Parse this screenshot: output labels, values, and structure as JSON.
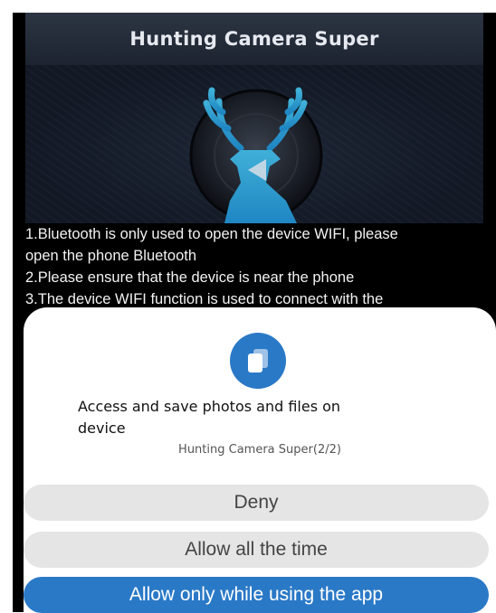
{
  "app": {
    "title": "Hunting Camera Super",
    "instructions": [
      "1.Bluetooth is only used to open the device WIFI, please",
      "open the phone Bluetooth",
      "2.Please ensure that the device is near the phone",
      "3.The device WIFI function is used to connect with the"
    ]
  },
  "dialog": {
    "icon": "files-icon",
    "title_line1": "Access and save photos and files on",
    "title_line2": "device",
    "subtitle": "Hunting Camera Super(2/2)",
    "buttons": {
      "deny": "Deny",
      "allow_all": "Allow all the time",
      "allow_while": "Allow only while using the app"
    }
  },
  "colors": {
    "accent": "#2a79c7",
    "button_gray": "#e5e5e5",
    "app_background": "#000000"
  }
}
